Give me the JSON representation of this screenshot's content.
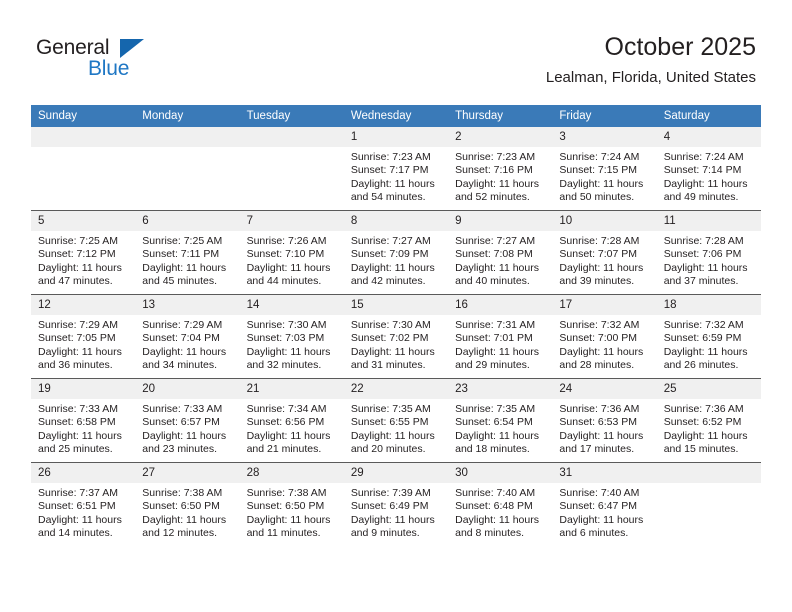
{
  "brand": {
    "name_top": "General",
    "name_bottom": "Blue",
    "accent_color": "#1f77c4",
    "triangle_color": "#1566ad",
    "text_color": "#231f20"
  },
  "header": {
    "title": "October 2025",
    "subtitle": "Lealman, Florida, United States",
    "header_bg": "#3a7ab8",
    "header_text_color": "#ffffff",
    "daynum_bg": "#f0f0f0"
  },
  "weekday_headers": [
    "Sunday",
    "Monday",
    "Tuesday",
    "Wednesday",
    "Thursday",
    "Friday",
    "Saturday"
  ],
  "weeks": [
    [
      {
        "day": "",
        "blank": true,
        "lines": []
      },
      {
        "day": "",
        "blank": true,
        "lines": []
      },
      {
        "day": "",
        "blank": true,
        "lines": []
      },
      {
        "day": "1",
        "blank": false,
        "lines": [
          "Sunrise: 7:23 AM",
          "Sunset: 7:17 PM",
          "Daylight: 11 hours",
          "and 54 minutes."
        ]
      },
      {
        "day": "2",
        "blank": false,
        "lines": [
          "Sunrise: 7:23 AM",
          "Sunset: 7:16 PM",
          "Daylight: 11 hours",
          "and 52 minutes."
        ]
      },
      {
        "day": "3",
        "blank": false,
        "lines": [
          "Sunrise: 7:24 AM",
          "Sunset: 7:15 PM",
          "Daylight: 11 hours",
          "and 50 minutes."
        ]
      },
      {
        "day": "4",
        "blank": false,
        "lines": [
          "Sunrise: 7:24 AM",
          "Sunset: 7:14 PM",
          "Daylight: 11 hours",
          "and 49 minutes."
        ]
      }
    ],
    [
      {
        "day": "5",
        "blank": false,
        "lines": [
          "Sunrise: 7:25 AM",
          "Sunset: 7:12 PM",
          "Daylight: 11 hours",
          "and 47 minutes."
        ]
      },
      {
        "day": "6",
        "blank": false,
        "lines": [
          "Sunrise: 7:25 AM",
          "Sunset: 7:11 PM",
          "Daylight: 11 hours",
          "and 45 minutes."
        ]
      },
      {
        "day": "7",
        "blank": false,
        "lines": [
          "Sunrise: 7:26 AM",
          "Sunset: 7:10 PM",
          "Daylight: 11 hours",
          "and 44 minutes."
        ]
      },
      {
        "day": "8",
        "blank": false,
        "lines": [
          "Sunrise: 7:27 AM",
          "Sunset: 7:09 PM",
          "Daylight: 11 hours",
          "and 42 minutes."
        ]
      },
      {
        "day": "9",
        "blank": false,
        "lines": [
          "Sunrise: 7:27 AM",
          "Sunset: 7:08 PM",
          "Daylight: 11 hours",
          "and 40 minutes."
        ]
      },
      {
        "day": "10",
        "blank": false,
        "lines": [
          "Sunrise: 7:28 AM",
          "Sunset: 7:07 PM",
          "Daylight: 11 hours",
          "and 39 minutes."
        ]
      },
      {
        "day": "11",
        "blank": false,
        "lines": [
          "Sunrise: 7:28 AM",
          "Sunset: 7:06 PM",
          "Daylight: 11 hours",
          "and 37 minutes."
        ]
      }
    ],
    [
      {
        "day": "12",
        "blank": false,
        "lines": [
          "Sunrise: 7:29 AM",
          "Sunset: 7:05 PM",
          "Daylight: 11 hours",
          "and 36 minutes."
        ]
      },
      {
        "day": "13",
        "blank": false,
        "lines": [
          "Sunrise: 7:29 AM",
          "Sunset: 7:04 PM",
          "Daylight: 11 hours",
          "and 34 minutes."
        ]
      },
      {
        "day": "14",
        "blank": false,
        "lines": [
          "Sunrise: 7:30 AM",
          "Sunset: 7:03 PM",
          "Daylight: 11 hours",
          "and 32 minutes."
        ]
      },
      {
        "day": "15",
        "blank": false,
        "lines": [
          "Sunrise: 7:30 AM",
          "Sunset: 7:02 PM",
          "Daylight: 11 hours",
          "and 31 minutes."
        ]
      },
      {
        "day": "16",
        "blank": false,
        "lines": [
          "Sunrise: 7:31 AM",
          "Sunset: 7:01 PM",
          "Daylight: 11 hours",
          "and 29 minutes."
        ]
      },
      {
        "day": "17",
        "blank": false,
        "lines": [
          "Sunrise: 7:32 AM",
          "Sunset: 7:00 PM",
          "Daylight: 11 hours",
          "and 28 minutes."
        ]
      },
      {
        "day": "18",
        "blank": false,
        "lines": [
          "Sunrise: 7:32 AM",
          "Sunset: 6:59 PM",
          "Daylight: 11 hours",
          "and 26 minutes."
        ]
      }
    ],
    [
      {
        "day": "19",
        "blank": false,
        "lines": [
          "Sunrise: 7:33 AM",
          "Sunset: 6:58 PM",
          "Daylight: 11 hours",
          "and 25 minutes."
        ]
      },
      {
        "day": "20",
        "blank": false,
        "lines": [
          "Sunrise: 7:33 AM",
          "Sunset: 6:57 PM",
          "Daylight: 11 hours",
          "and 23 minutes."
        ]
      },
      {
        "day": "21",
        "blank": false,
        "lines": [
          "Sunrise: 7:34 AM",
          "Sunset: 6:56 PM",
          "Daylight: 11 hours",
          "and 21 minutes."
        ]
      },
      {
        "day": "22",
        "blank": false,
        "lines": [
          "Sunrise: 7:35 AM",
          "Sunset: 6:55 PM",
          "Daylight: 11 hours",
          "and 20 minutes."
        ]
      },
      {
        "day": "23",
        "blank": false,
        "lines": [
          "Sunrise: 7:35 AM",
          "Sunset: 6:54 PM",
          "Daylight: 11 hours",
          "and 18 minutes."
        ]
      },
      {
        "day": "24",
        "blank": false,
        "lines": [
          "Sunrise: 7:36 AM",
          "Sunset: 6:53 PM",
          "Daylight: 11 hours",
          "and 17 minutes."
        ]
      },
      {
        "day": "25",
        "blank": false,
        "lines": [
          "Sunrise: 7:36 AM",
          "Sunset: 6:52 PM",
          "Daylight: 11 hours",
          "and 15 minutes."
        ]
      }
    ],
    [
      {
        "day": "26",
        "blank": false,
        "lines": [
          "Sunrise: 7:37 AM",
          "Sunset: 6:51 PM",
          "Daylight: 11 hours",
          "and 14 minutes."
        ]
      },
      {
        "day": "27",
        "blank": false,
        "lines": [
          "Sunrise: 7:38 AM",
          "Sunset: 6:50 PM",
          "Daylight: 11 hours",
          "and 12 minutes."
        ]
      },
      {
        "day": "28",
        "blank": false,
        "lines": [
          "Sunrise: 7:38 AM",
          "Sunset: 6:50 PM",
          "Daylight: 11 hours",
          "and 11 minutes."
        ]
      },
      {
        "day": "29",
        "blank": false,
        "lines": [
          "Sunrise: 7:39 AM",
          "Sunset: 6:49 PM",
          "Daylight: 11 hours",
          "and 9 minutes."
        ]
      },
      {
        "day": "30",
        "blank": false,
        "lines": [
          "Sunrise: 7:40 AM",
          "Sunset: 6:48 PM",
          "Daylight: 11 hours",
          "and 8 minutes."
        ]
      },
      {
        "day": "31",
        "blank": false,
        "lines": [
          "Sunrise: 7:40 AM",
          "Sunset: 6:47 PM",
          "Daylight: 11 hours",
          "and 6 minutes."
        ]
      },
      {
        "day": "",
        "blank": true,
        "lines": []
      }
    ]
  ]
}
